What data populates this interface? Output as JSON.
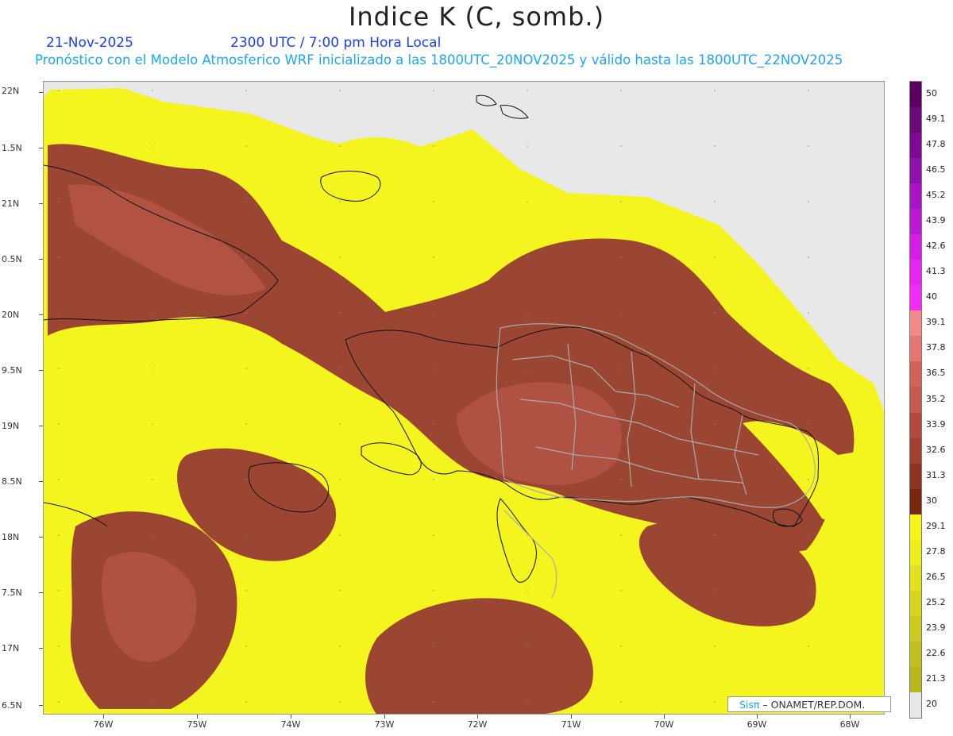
{
  "header": {
    "title": "Indice K (C, somb.)",
    "date": "21-Nov-2025",
    "time": "2300 UTC / 7:00 pm Hora Local",
    "subtitle": "Pronóstico con el Modelo Atmosferico WRF inicializado a las 1800UTC_20NOV2025 y válido hasta las  1800UTC_22NOV2025"
  },
  "axes": {
    "lat_labels": [
      "22N",
      "1.5N",
      "21N",
      "0.5N",
      "20N",
      "9.5N",
      "19N",
      "8.5N",
      "18N",
      "7.5N",
      "17N",
      "6.5N"
    ],
    "lon_labels": [
      "76W",
      "75W",
      "74W",
      "73W",
      "72W",
      "71W",
      "70W",
      "69W",
      "68W"
    ]
  },
  "credit": {
    "sis": "Sisπ",
    "org": "– ONAMET/REP.DOM."
  },
  "legend": {
    "levels": [
      "50",
      "49.1",
      "47.8",
      "46.5",
      "45.2",
      "43.9",
      "42.6",
      "41.3",
      "40",
      "39.1",
      "37.8",
      "36.5",
      "35.2",
      "33.9",
      "32.6",
      "31.3",
      "30",
      "29.1",
      "27.8",
      "26.5",
      "25.2",
      "23.9",
      "22.6",
      "21.3",
      "20"
    ],
    "colors": [
      "#5a0060",
      "#6a0a78",
      "#7d0a92",
      "#9010ac",
      "#a614c4",
      "#bd18d6",
      "#d41ee6",
      "#e626f0",
      "#f22cf6",
      "#f28a8a",
      "#e37670",
      "#d2625a",
      "#c45a50",
      "#b24a40",
      "#a0402e",
      "#8c3420",
      "#78280f",
      "#f5f51c",
      "#eded1c",
      "#e1e11e",
      "#d6d61e",
      "#cbcb20",
      "#c0c020",
      "#b8b81e",
      "#e8e8e8"
    ]
  },
  "colors": {
    "yellow": "#f5f51c",
    "yellow_light": "#f0f22a",
    "brown": "#9b4632",
    "brown_light": "#b8574a",
    "pink_highlight": "#cf6b60",
    "nodata": "#e8e8e8",
    "coast": "#111111",
    "border": "#aaaaaa"
  }
}
